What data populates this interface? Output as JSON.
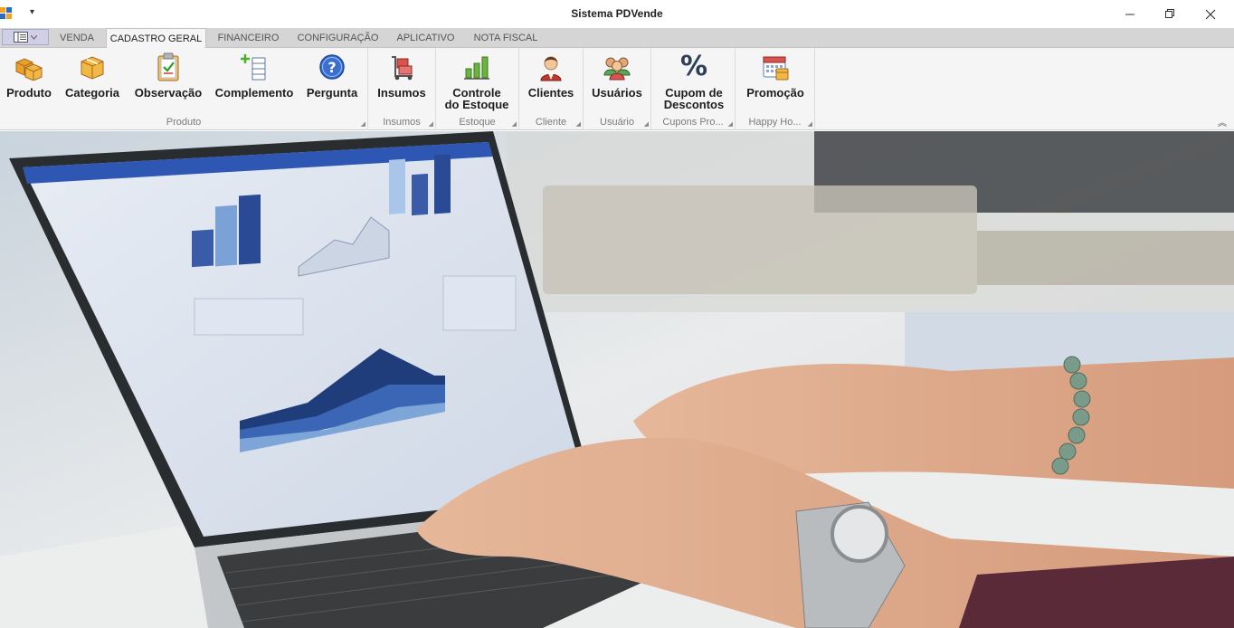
{
  "window": {
    "title": "Sistema PDVende",
    "qat_arrow": "▾",
    "minimize": "─",
    "maximize": "❐",
    "close": "✕"
  },
  "tabs": [
    {
      "label": "VENDA",
      "active": false
    },
    {
      "label": "CADASTRO GERAL",
      "active": true
    },
    {
      "label": "FINANCEIRO",
      "active": false
    },
    {
      "label": "CONFIGURAÇÃO",
      "active": false
    },
    {
      "label": "APLICATIVO",
      "active": false
    },
    {
      "label": "NOTA FISCAL",
      "active": false
    }
  ],
  "ribbon": {
    "groups": [
      {
        "label": "Produto",
        "buttons": [
          {
            "label": "Produto",
            "icon": "boxes-icon"
          },
          {
            "label": "Categoria",
            "icon": "box-icon"
          },
          {
            "label": "Observação",
            "icon": "clipboard-check-icon"
          },
          {
            "label": "Complemento",
            "icon": "list-add-icon"
          },
          {
            "label": "Pergunta",
            "icon": "help-icon"
          }
        ]
      },
      {
        "label": "Insumos",
        "buttons": [
          {
            "label": "Insumos",
            "icon": "hand-truck-icon"
          }
        ]
      },
      {
        "label": "Estoque",
        "buttons": [
          {
            "label": "Controle\ndo Estoque",
            "icon": "bar-chart-icon"
          }
        ]
      },
      {
        "label": "Cliente",
        "buttons": [
          {
            "label": "Clientes",
            "icon": "customer-icon"
          }
        ]
      },
      {
        "label": "Usuário",
        "buttons": [
          {
            "label": "Usuários",
            "icon": "users-icon"
          }
        ]
      },
      {
        "label": "Cupons Pro...",
        "buttons": [
          {
            "label": "Cupom de\nDescontos",
            "icon": "percent-icon"
          }
        ]
      },
      {
        "label": "Happy Ho...",
        "buttons": [
          {
            "label": "Promoção",
            "icon": "calendar-icon"
          }
        ]
      }
    ],
    "percent_glyph": "%",
    "collapse_glyph": "︽"
  },
  "colors": {
    "accent": "#2b579a",
    "tab_strip": "#d5d5d5",
    "ribbon_bg": "#f5f5f5"
  }
}
